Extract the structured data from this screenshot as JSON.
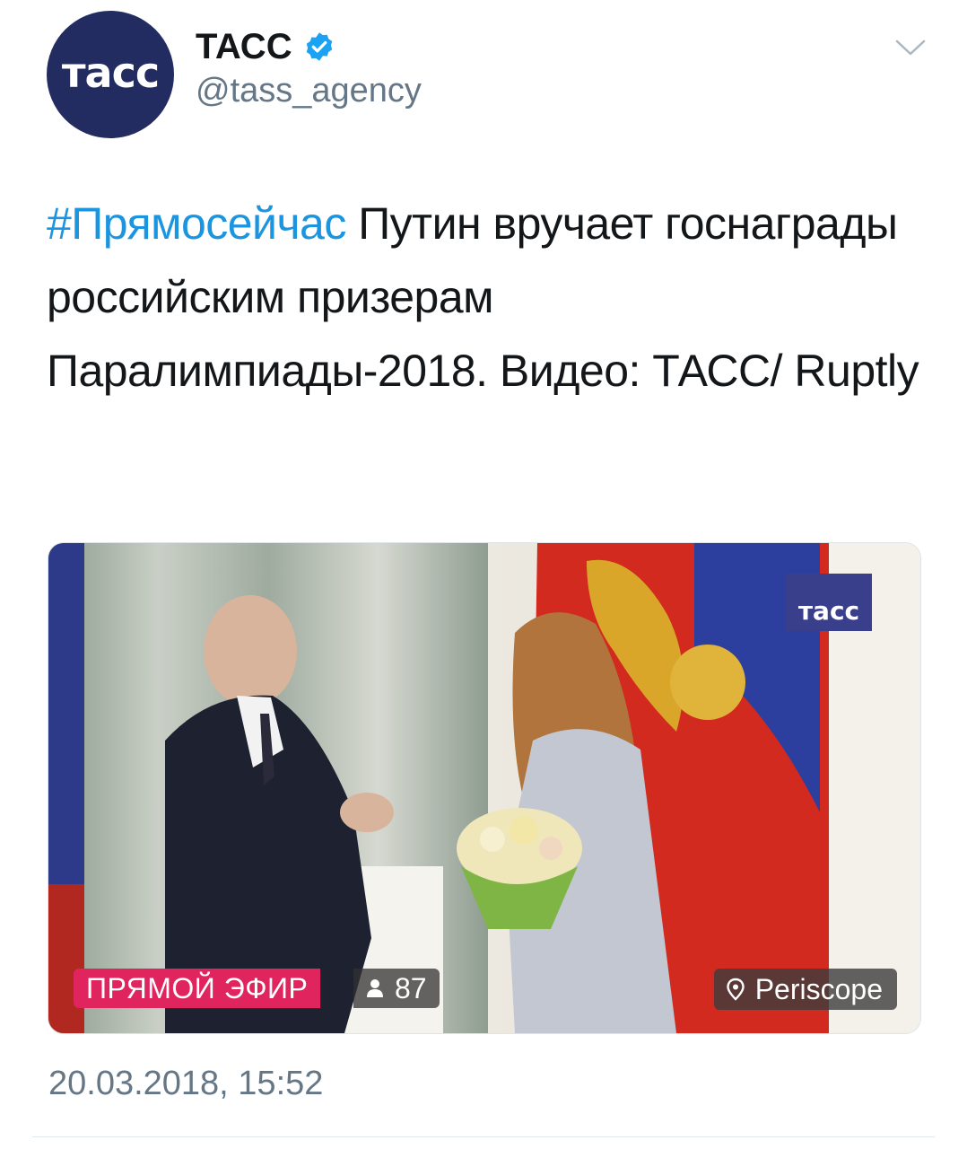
{
  "author": {
    "avatar_text": "тасс",
    "display_name": "ТАСС",
    "handle": "@tass_agency",
    "verified": true
  },
  "tweet": {
    "hashtag": "#Прямосейчас",
    "text": " Путин вручает госнаграды российским призерам Паралимпиады-2018. Видео: ТАСС/ Ruptly",
    "timestamp": "20.03.2018, 15:52"
  },
  "media": {
    "watermark": "тасс",
    "live_label": "ПРЯМОЙ ЭФИР",
    "viewer_count": "87",
    "source_label": "Periscope"
  },
  "icons": {
    "verified": "verified-badge-icon",
    "caret": "chevron-down-icon",
    "viewers": "person-icon",
    "periscope": "periscope-pin-icon"
  },
  "colors": {
    "hashtag": "#1b95e0",
    "live": "#e0245e",
    "avatar_bg": "#232c61",
    "secondary_text": "#657786"
  }
}
